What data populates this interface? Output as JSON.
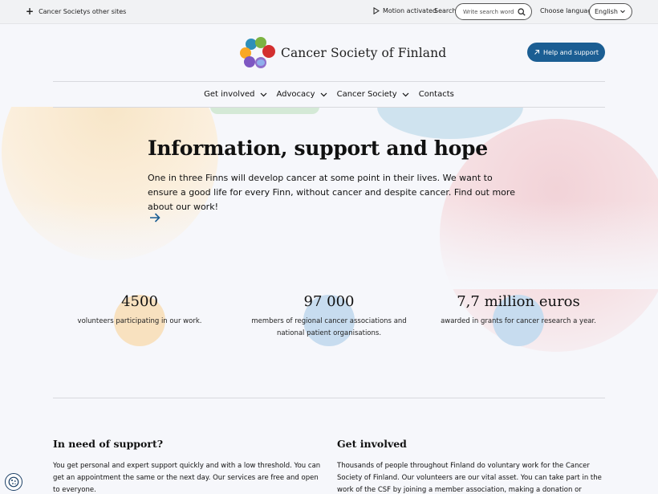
{
  "topbar": {
    "other_sites": "Cancer Societys other sites",
    "motion": "Motion activated",
    "search_label": "Search",
    "search_placeholder": "Write search word",
    "language_label": "Choose language",
    "language_value": "English"
  },
  "header": {
    "logo_text": "Cancer Society of Finland",
    "help_button": "Help and support"
  },
  "nav": {
    "items": [
      {
        "label": "Get involved",
        "has_dropdown": true
      },
      {
        "label": "Advocacy",
        "has_dropdown": true
      },
      {
        "label": "Cancer Society",
        "has_dropdown": true
      },
      {
        "label": "Contacts",
        "has_dropdown": false
      }
    ]
  },
  "hero": {
    "title": "Information, support and hope",
    "body": "One in three Finns will develop cancer at some point in their lives. We want to ensure a good life for every Finn, without cancer and despite cancer. Find out more about our work!"
  },
  "stats": [
    {
      "value": "4500",
      "description": "volunteers participating in our work.",
      "dot_color": "#f8e1bf"
    },
    {
      "value": "97 000",
      "description": "members of regional cancer associations and national patient organisations.",
      "dot_color": "#c7dcef"
    },
    {
      "value": "7,7 million euros",
      "description": "awarded in grants for cancer research a year.",
      "dot_color": "#c7dcef"
    }
  ],
  "support": {
    "title": "In need of support?",
    "body": "You get personal and expert support quickly and with a low threshold. You can get an appointment the same or the next day. Our services are free and open to everyone."
  },
  "involved": {
    "title": "Get involved",
    "body": "Thousands of people throughout Finland do voluntary work for the Cancer Society of Finland. Our volunteers are our vital asset. You can take part in the work of the CSF by joining a member association, making a donation or volunteering."
  },
  "colors": {
    "primary": "#1b5e93",
    "text": "#111111",
    "background": "#f6f7fb"
  }
}
